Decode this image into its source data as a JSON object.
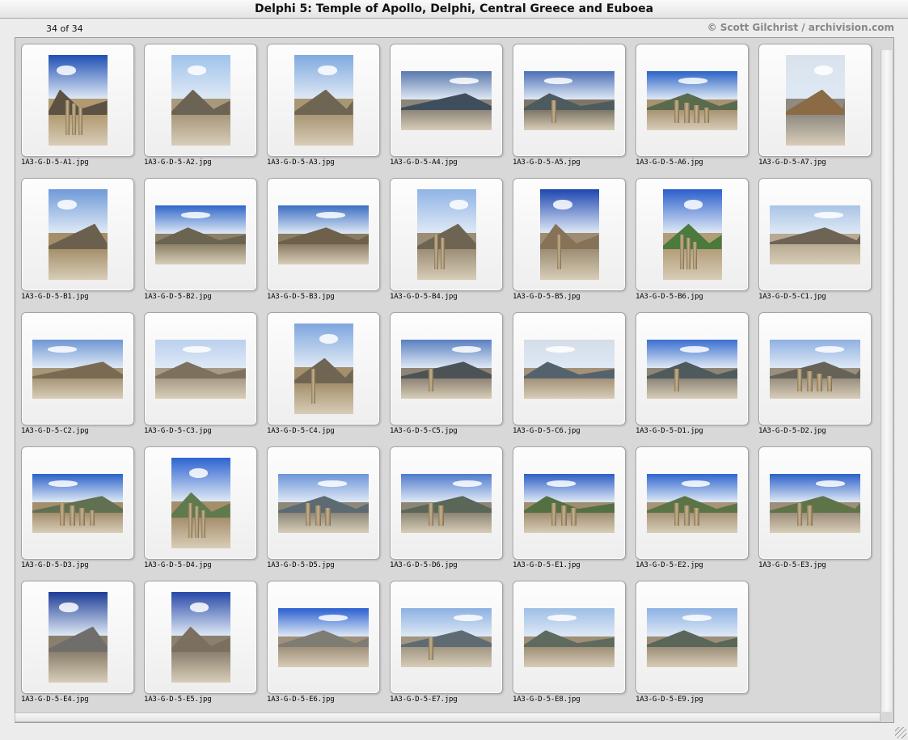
{
  "window": {
    "title": "Delphi 5: Temple of Apollo, Delphi, Central Greece and Euboea",
    "count_label": "34 of 34",
    "credit": "© Scott Gilchrist / archivision.com"
  },
  "slides": [
    {
      "filename": "1A3-G-D-5-A1.jpg",
      "orientation": "portrait",
      "sky": "#1f4fb3",
      "mountain": "#5b5244",
      "ground": "#b19a72",
      "columns": 3
    },
    {
      "filename": "1A3-G-D-5-A2.jpg",
      "orientation": "portrait",
      "sky": "#9fc3ea",
      "mountain": "#6b6455",
      "ground": "#a8987c",
      "columns": 0
    },
    {
      "filename": "1A3-G-D-5-A3.jpg",
      "orientation": "portrait",
      "sky": "#7fa9df",
      "mountain": "#6f6553",
      "ground": "#a99774",
      "columns": 0
    },
    {
      "filename": "1A3-G-D-5-A4.jpg",
      "orientation": "landscape",
      "sky": "#5a79ad",
      "mountain": "#3f4e5c",
      "ground": "#8c857a",
      "columns": 0
    },
    {
      "filename": "1A3-G-D-5-A5.jpg",
      "orientation": "landscape",
      "sky": "#4c6fb5",
      "mountain": "#4d5a5e",
      "ground": "#7d7566",
      "columns": 1
    },
    {
      "filename": "1A3-G-D-5-A6.jpg",
      "orientation": "landscape",
      "sky": "#2a63c6",
      "mountain": "#5a6a4c",
      "ground": "#a89272",
      "columns": 4
    },
    {
      "filename": "1A3-G-D-5-A7.jpg",
      "orientation": "portrait",
      "sky": "#d9e2ec",
      "mountain": "#8a6b45",
      "ground": "#8f8a82",
      "columns": 0
    },
    {
      "filename": "1A3-G-D-5-B1.jpg",
      "orientation": "portrait",
      "sky": "#6f9ad8",
      "mountain": "#6b604e",
      "ground": "#a58f6a",
      "columns": 0
    },
    {
      "filename": "1A3-G-D-5-B2.jpg",
      "orientation": "landscape",
      "sky": "#2f67c9",
      "mountain": "#6a6450",
      "ground": "#8d8068",
      "columns": 0
    },
    {
      "filename": "1A3-G-D-5-B3.jpg",
      "orientation": "landscape",
      "sky": "#3b6fc2",
      "mountain": "#6f604c",
      "ground": "#8a7b63",
      "columns": 0
    },
    {
      "filename": "1A3-G-D-5-B4.jpg",
      "orientation": "portrait",
      "sky": "#8fb4e6",
      "mountain": "#6e6452",
      "ground": "#9b8d76",
      "columns": 2
    },
    {
      "filename": "1A3-G-D-5-B5.jpg",
      "orientation": "portrait",
      "sky": "#1e46b0",
      "mountain": "#857257",
      "ground": "#9d8d73",
      "columns": 1
    },
    {
      "filename": "1A3-G-D-5-B6.jpg",
      "orientation": "portrait",
      "sky": "#2b5fcc",
      "mountain": "#4b7a3c",
      "ground": "#b39d79",
      "columns": 3
    },
    {
      "filename": "1A3-G-D-5-C1.jpg",
      "orientation": "landscape",
      "sky": "#a9c4e6",
      "mountain": "#6d6456",
      "ground": "#b7aa92",
      "columns": 0
    },
    {
      "filename": "1A3-G-D-5-C2.jpg",
      "orientation": "landscape",
      "sky": "#6f96d4",
      "mountain": "#7a6a52",
      "ground": "#a79679",
      "columns": 0
    },
    {
      "filename": "1A3-G-D-5-C3.jpg",
      "orientation": "landscape",
      "sky": "#b9d0ee",
      "mountain": "#7d705c",
      "ground": "#a79a86",
      "columns": 0
    },
    {
      "filename": "1A3-G-D-5-C4.jpg",
      "orientation": "portrait",
      "sky": "#7ea6de",
      "mountain": "#6f6552",
      "ground": "#a48f6c",
      "columns": 1
    },
    {
      "filename": "1A3-G-D-5-C5.jpg",
      "orientation": "landscape",
      "sky": "#5a7fc0",
      "mountain": "#4b5356",
      "ground": "#8f8475",
      "columns": 1
    },
    {
      "filename": "1A3-G-D-5-C6.jpg",
      "orientation": "landscape",
      "sky": "#d4dde8",
      "mountain": "#54626d",
      "ground": "#a39178",
      "columns": 0
    },
    {
      "filename": "1A3-G-D-5-D1.jpg",
      "orientation": "landscape",
      "sky": "#3b6fd0",
      "mountain": "#4f5a5c",
      "ground": "#8d8577",
      "columns": 1
    },
    {
      "filename": "1A3-G-D-5-D2.jpg",
      "orientation": "landscape",
      "sky": "#8fb0e2",
      "mountain": "#666258",
      "ground": "#99907f",
      "columns": 4
    },
    {
      "filename": "1A3-G-D-5-D3.jpg",
      "orientation": "landscape",
      "sky": "#2b62c9",
      "mountain": "#607050",
      "ground": "#a38e6d",
      "columns": 4
    },
    {
      "filename": "1A3-G-D-5-D4.jpg",
      "orientation": "portrait",
      "sky": "#2d63d0",
      "mountain": "#5f7a4c",
      "ground": "#a58e6a",
      "columns": 3
    },
    {
      "filename": "1A3-G-D-5-D5.jpg",
      "orientation": "landscape",
      "sky": "#6d95d8",
      "mountain": "#5b6a73",
      "ground": "#8c8779",
      "columns": 3
    },
    {
      "filename": "1A3-G-D-5-D6.jpg",
      "orientation": "landscape",
      "sky": "#4f7bcc",
      "mountain": "#596658",
      "ground": "#8c8575",
      "columns": 2
    },
    {
      "filename": "1A3-G-D-5-E1.jpg",
      "orientation": "landscape",
      "sky": "#2d5fc4",
      "mountain": "#527042",
      "ground": "#9f8d70",
      "columns": 3
    },
    {
      "filename": "1A3-G-D-5-E2.jpg",
      "orientation": "landscape",
      "sky": "#2f66cf",
      "mountain": "#5b7446",
      "ground": "#a69478",
      "columns": 3
    },
    {
      "filename": "1A3-G-D-5-E3.jpg",
      "orientation": "landscape",
      "sky": "#2c61c9",
      "mountain": "#5f7349",
      "ground": "#9c8e7a",
      "columns": 2
    },
    {
      "filename": "1A3-G-D-5-E4.jpg",
      "orientation": "portrait",
      "sky": "#1d3c95",
      "mountain": "#6f6e6a",
      "ground": "#8a7f6c",
      "columns": 0
    },
    {
      "filename": "1A3-G-D-5-E5.jpg",
      "orientation": "portrait",
      "sky": "#2748a8",
      "mountain": "#7b705f",
      "ground": "#8a8070",
      "columns": 0
    },
    {
      "filename": "1A3-G-D-5-E6.jpg",
      "orientation": "landscape",
      "sky": "#2a5fd0",
      "mountain": "#7f7c74",
      "ground": "#a0907a",
      "columns": 0
    },
    {
      "filename": "1A3-G-D-5-E7.jpg",
      "orientation": "landscape",
      "sky": "#8cb0e2",
      "mountain": "#5f6b72",
      "ground": "#a09682",
      "columns": 1
    },
    {
      "filename": "1A3-G-D-5-E8.jpg",
      "orientation": "landscape",
      "sky": "#9ebfe6",
      "mountain": "#5f6a5f",
      "ground": "#9f8f76",
      "columns": 0
    },
    {
      "filename": "1A3-G-D-5-E9.jpg",
      "orientation": "landscape",
      "sky": "#8db2e4",
      "mountain": "#5a6657",
      "ground": "#9c8f79",
      "columns": 0
    }
  ]
}
